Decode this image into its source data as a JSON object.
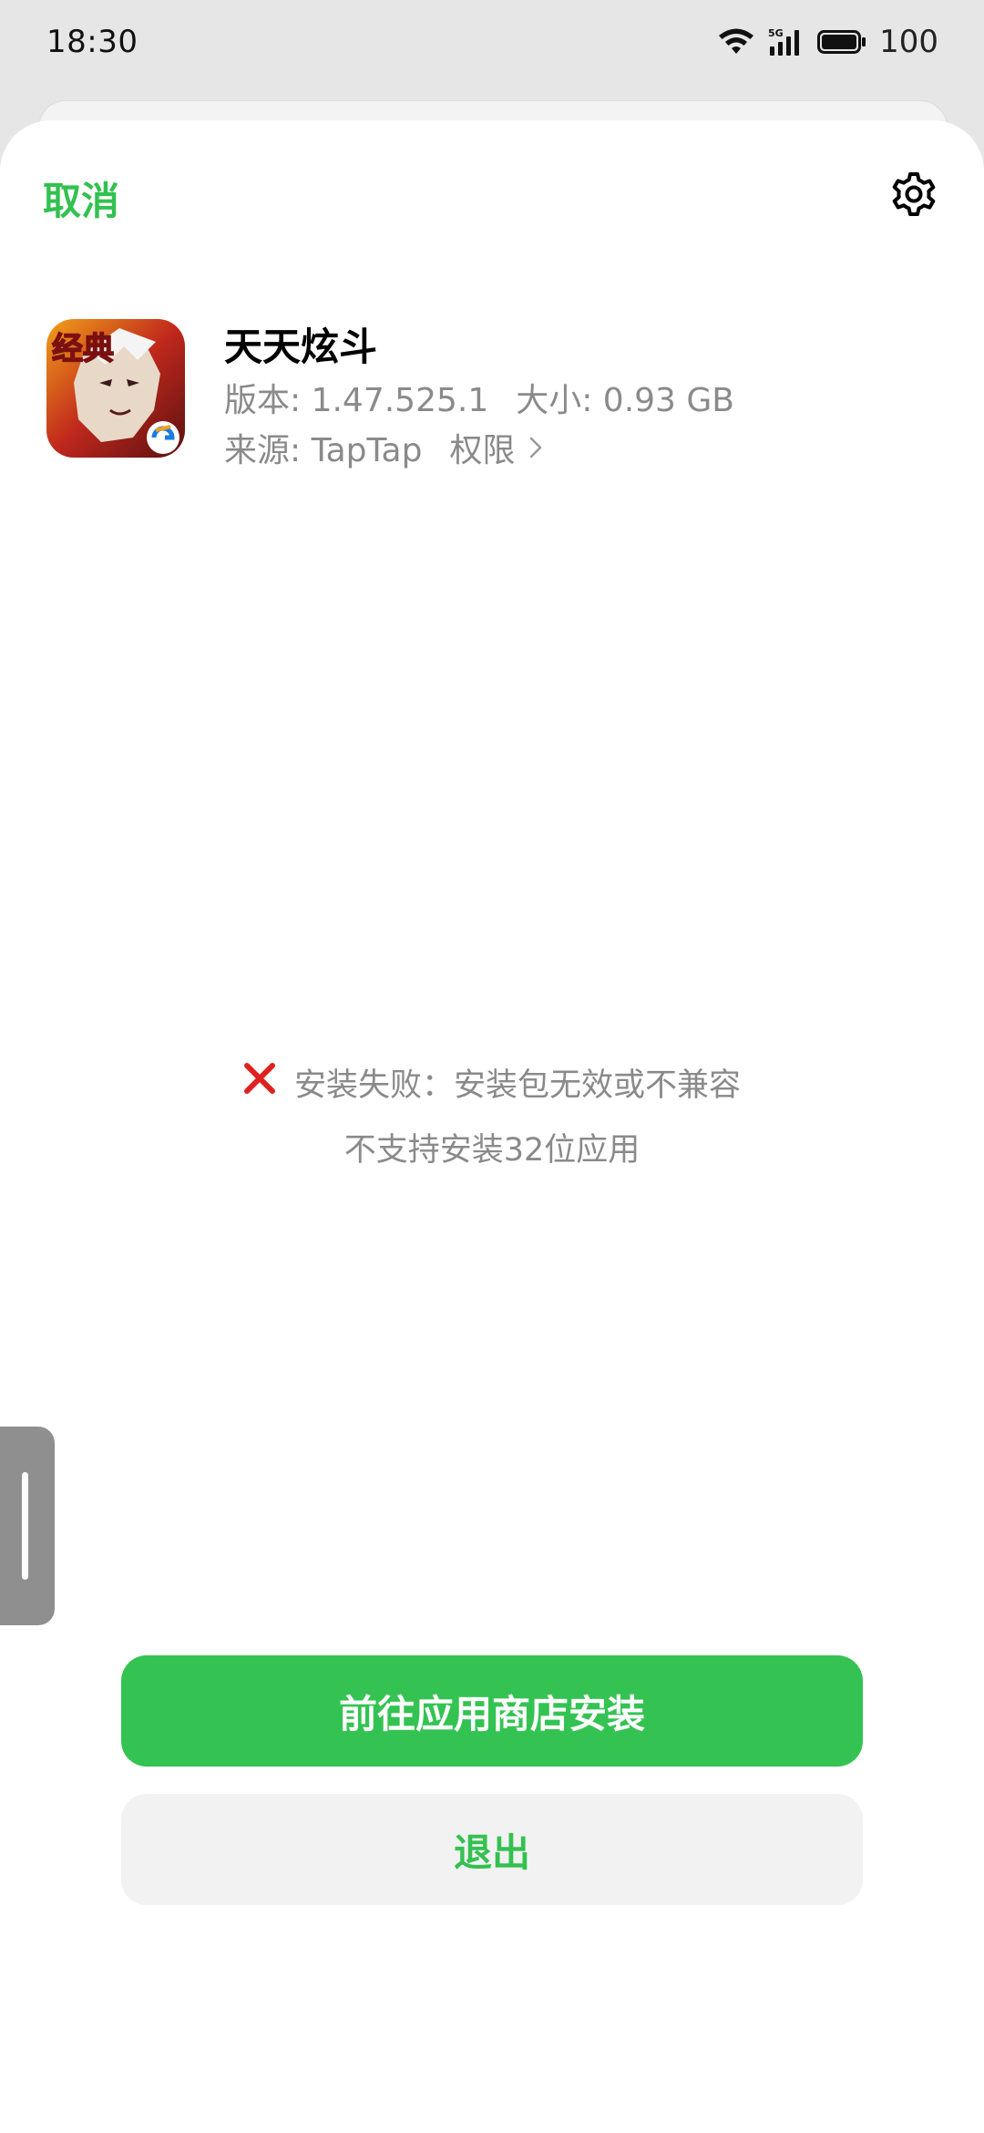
{
  "status_bar": {
    "time": "18:30",
    "network_label": "5G",
    "battery_level": "100",
    "icons": [
      "wifi-icon",
      "signal-5g-icon",
      "battery-icon"
    ]
  },
  "header": {
    "cancel_label": "取消",
    "settings_icon": "gear-icon"
  },
  "app": {
    "name": "天天炫斗",
    "icon_badge_text": "经典",
    "version_label": "版本: 1.47.525.1",
    "size_label": "大小: 0.93 GB",
    "source_label": "来源: TapTap",
    "permissions_label": "权限"
  },
  "error": {
    "icon": "error-x-icon",
    "line1": "安装失败：安装包无效或不兼容",
    "line2": "不支持安装32位应用"
  },
  "buttons": {
    "primary_label": "前往应用商店安装",
    "secondary_label": "退出"
  },
  "colors": {
    "accent_green": "#34c352",
    "error_red": "#e02020",
    "muted_text": "#8a8a8a"
  }
}
